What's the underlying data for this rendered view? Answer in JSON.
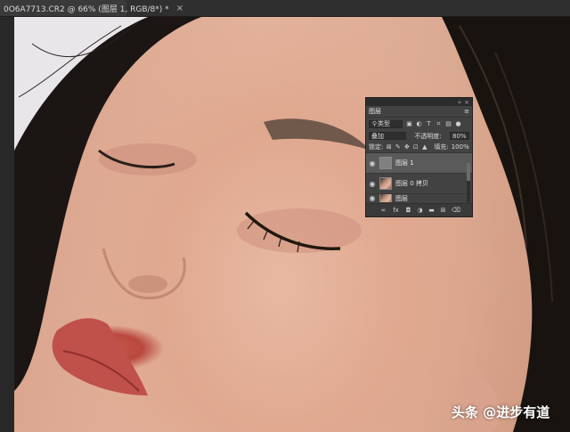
{
  "document": {
    "tab_title": "0O6A7713.CR2 @ 66% (图层 1, RGB/8*) *",
    "close_glyph": "×"
  },
  "layers_panel": {
    "title": "图层",
    "menu_glyph": "≡",
    "collapse_glyph": "«",
    "close_glyph": "×",
    "filter_label": "类型",
    "blend_mode": "叠加",
    "opacity_label": "不透明度:",
    "opacity_value": "80%",
    "lock_label": "锁定:",
    "fill_label": "填充:",
    "fill_value": "100%",
    "layers": [
      {
        "name": "图层 1",
        "visible": true,
        "selected": true,
        "thumb": "gray"
      },
      {
        "name": "图层 0 拷贝",
        "visible": true,
        "selected": false,
        "thumb": "face"
      },
      {
        "name": "图层",
        "visible": true,
        "selected": false,
        "thumb": "face"
      }
    ],
    "bottom_icons": [
      "link-icon",
      "fx-icon",
      "mask-icon",
      "adjustment-icon",
      "group-icon",
      "new-layer-icon",
      "trash-icon"
    ]
  },
  "watermark": {
    "text": "头条 @进步有道"
  },
  "colors": {
    "ui_dark": "#2b2b2b",
    "panel_bg": "#424242",
    "selected_layer": "#5a5a5a",
    "skin": "#e0ad95",
    "lips": "#c0504a",
    "hair": "#1b1613"
  }
}
